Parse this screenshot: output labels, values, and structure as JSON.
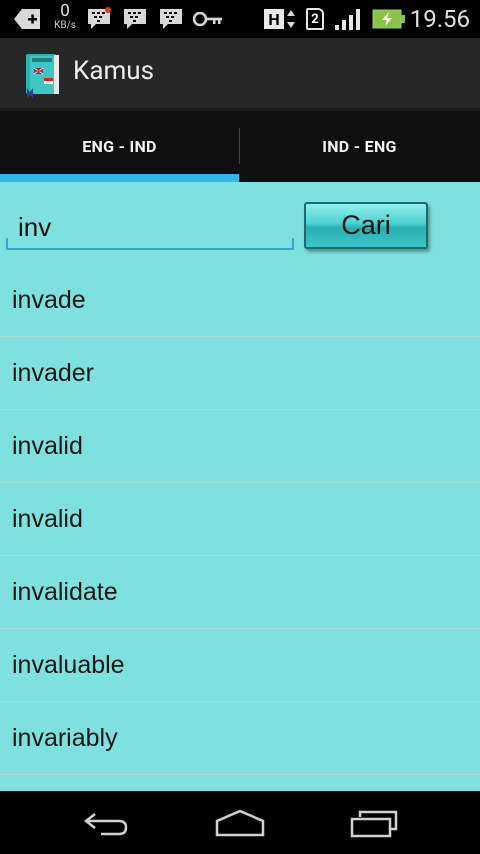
{
  "status_bar": {
    "speed_value": "0",
    "speed_unit": "KB/s",
    "sim_slot": "2",
    "network_type": "H",
    "time": "19.56",
    "icons": [
      "add-icon",
      "bbm-icon",
      "bbm-icon",
      "bbm-icon",
      "key-icon",
      "network-type-icon",
      "sim-icon",
      "signal-icon",
      "battery-charging-icon"
    ]
  },
  "action_bar": {
    "title": "Kamus",
    "icon": "dictionary-book-icon"
  },
  "tabs": [
    {
      "label": "ENG - IND",
      "selected": true
    },
    {
      "label": "IND - ENG",
      "selected": false
    }
  ],
  "search": {
    "value": "inv",
    "button_label": "Cari"
  },
  "results": [
    "invade",
    "invader",
    "invalid",
    "invalid",
    "invalidate",
    "invaluable",
    "invariably"
  ],
  "nav_bar": {
    "icons": [
      "back-icon",
      "home-icon",
      "recent-apps-icon"
    ]
  },
  "colors": {
    "content_bg": "#7ee0df",
    "tab_indicator": "#33b5e5",
    "button_teal": "#3ec6c8"
  }
}
